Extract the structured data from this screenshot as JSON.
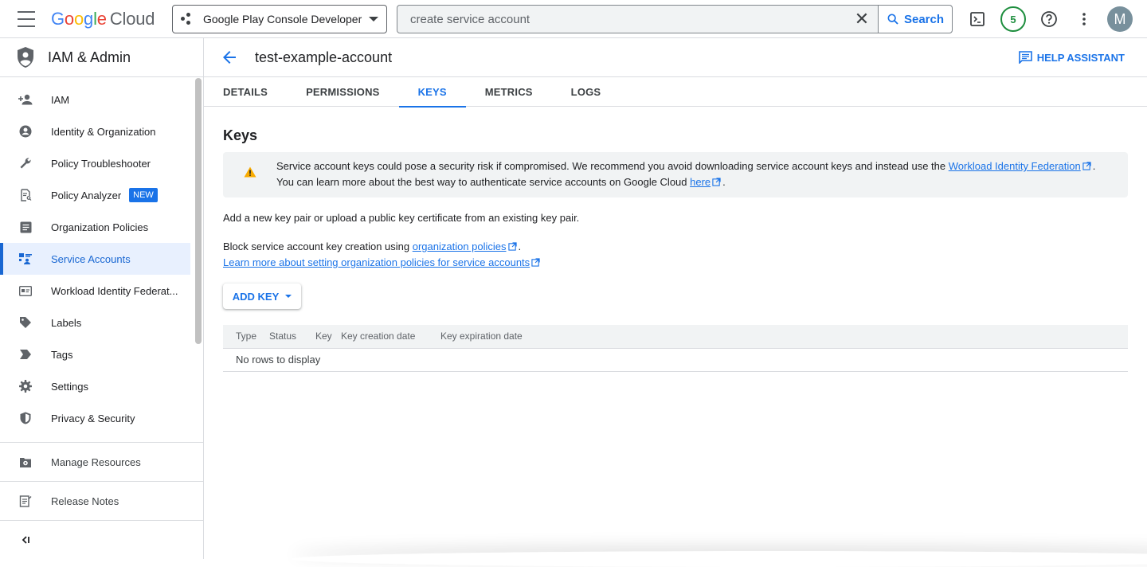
{
  "topbar": {
    "logo_letters": [
      "G",
      "o",
      "o",
      "g",
      "l",
      "e"
    ],
    "logo_suffix": "Cloud",
    "project_name": "Google Play Console Developer",
    "search_value": "create service account",
    "search_button": "Search",
    "notification_count": "5",
    "avatar_letter": "M"
  },
  "sidebar": {
    "title": "IAM & Admin",
    "items": [
      {
        "label": "IAM",
        "icon": "person-add-icon"
      },
      {
        "label": "Identity & Organization",
        "icon": "account-circle-icon"
      },
      {
        "label": "Policy Troubleshooter",
        "icon": "wrench-icon"
      },
      {
        "label": "Policy Analyzer",
        "icon": "document-search-icon",
        "badge": "NEW"
      },
      {
        "label": "Organization Policies",
        "icon": "list-document-icon"
      },
      {
        "label": "Service Accounts",
        "icon": "service-account-icon",
        "active": true
      },
      {
        "label": "Workload Identity Federat...",
        "icon": "id-card-icon"
      },
      {
        "label": "Labels",
        "icon": "label-icon"
      },
      {
        "label": "Tags",
        "icon": "tag-arrow-icon"
      },
      {
        "label": "Settings",
        "icon": "gear-icon"
      },
      {
        "label": "Privacy & Security",
        "icon": "shield-icon"
      }
    ],
    "bottom": [
      {
        "label": "Manage Resources",
        "icon": "manage-resources-icon"
      },
      {
        "label": "Release Notes",
        "icon": "release-notes-icon"
      }
    ],
    "collapse_icon": "collapse-icon"
  },
  "main": {
    "title": "test-example-account",
    "help": "HELP ASSISTANT",
    "tabs": [
      "DETAILS",
      "PERMISSIONS",
      "KEYS",
      "METRICS",
      "LOGS"
    ],
    "active_tab": "KEYS",
    "heading": "Keys",
    "warning": {
      "text1": "Service account keys could pose a security risk if compromised. We recommend you avoid downloading service account keys and instead use the ",
      "link1": "Workload Identity Federation",
      "text2": ". You can learn more about the best way to authenticate service accounts on Google Cloud ",
      "link2": "here",
      "text3": "."
    },
    "add_text": "Add a new key pair or upload a public key certificate from an existing key pair.",
    "block_text": "Block service account key creation using ",
    "block_link": "organization policies",
    "block_end": ".",
    "learn_link": "Learn more about setting organization policies for service accounts",
    "add_key_button": "ADD KEY",
    "table": {
      "columns": [
        "Type",
        "Status",
        "Key",
        "Key creation date",
        "Key expiration date"
      ],
      "empty": "No rows to display"
    }
  },
  "colors": {
    "accent": "#1a73e8",
    "active_bg": "#e8f0fe",
    "warning": "#f9ab00",
    "badge_green": "#1e8e3e"
  }
}
